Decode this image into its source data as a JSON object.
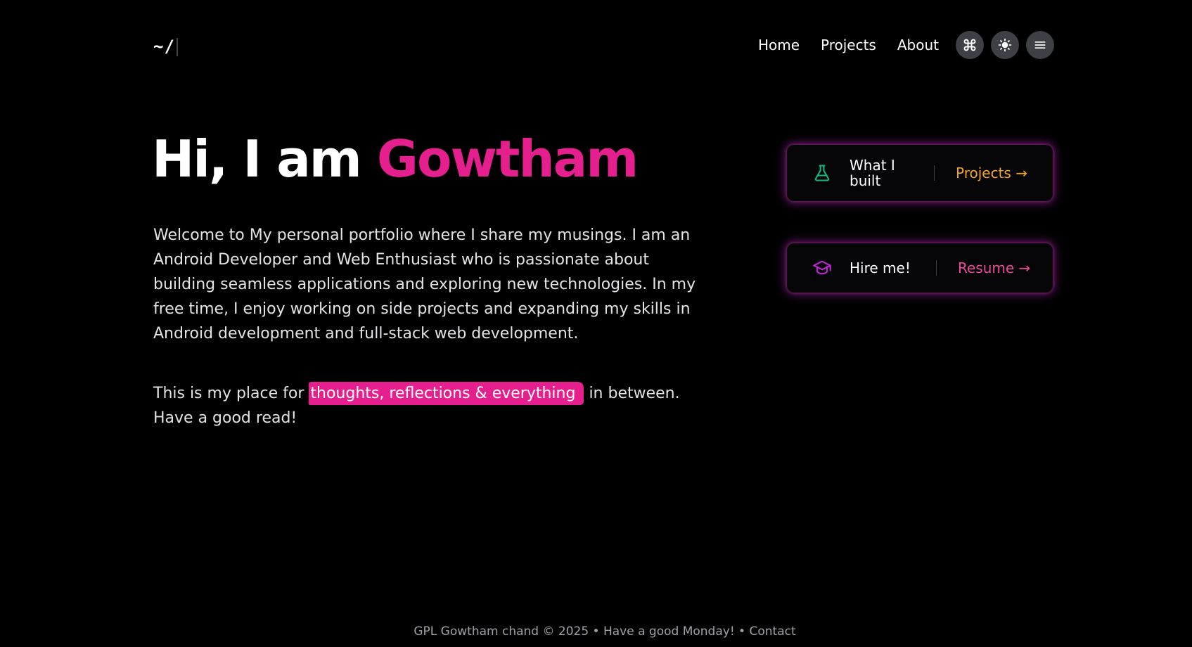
{
  "header": {
    "logo": "~/",
    "nav": {
      "home": "Home",
      "projects": "Projects",
      "about": "About"
    },
    "icons": [
      "command-icon",
      "sun-icon",
      "menu-icon"
    ]
  },
  "hero": {
    "greeting": "Hi, I am",
    "name": "Gowtham",
    "intro": "Welcome to My personal portfolio where I share my musings. I am an Android Developer and Web Enthusiast who is passionate about building seamless applications and exploring new technologies. In my free time, I enjoy working on side projects and expanding my skills in Android development and full-stack web development.",
    "tagline_before": "This is my place for",
    "tagline_highlight": "thoughts, reflections & everything",
    "tagline_after": "in between. Have a good read!"
  },
  "cards": [
    {
      "label": "What I built",
      "link": "Projects →",
      "icon": "flask-icon",
      "icon_color": "#10b981",
      "link_color": "#f5a524"
    },
    {
      "label": "Hire me!",
      "link": "Resume →",
      "icon": "graduation-cap-icon",
      "icon_color": "#c026d3",
      "link_color": "#ec4899"
    }
  ],
  "footer": {
    "text": "GPL Gowtham chand © 2025 • Have a good Monday! •",
    "contact": "Contact"
  },
  "colors": {
    "accent": "#e51f8d",
    "background": "#000000"
  }
}
